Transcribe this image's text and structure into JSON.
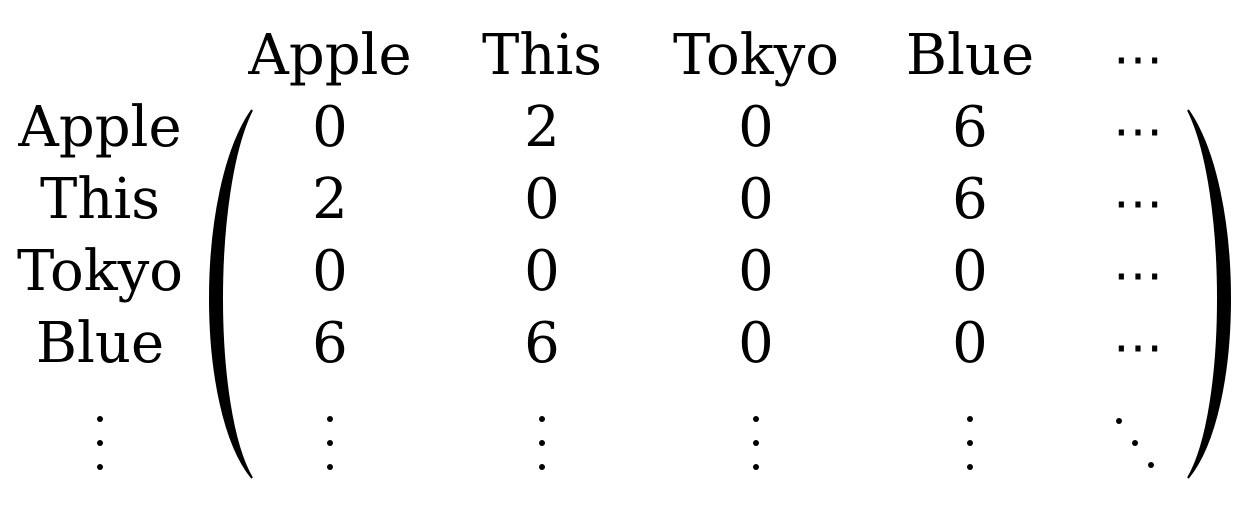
{
  "matrix": {
    "column_labels": [
      "Apple",
      "This",
      "Tokyo",
      "Blue"
    ],
    "row_labels": [
      "Apple",
      "This",
      "Tokyo",
      "Blue"
    ],
    "values": [
      [
        "0",
        "2",
        "0",
        "6"
      ],
      [
        "2",
        "0",
        "0",
        "6"
      ],
      [
        "0",
        "0",
        "0",
        "0"
      ],
      [
        "6",
        "6",
        "0",
        "0"
      ]
    ],
    "continuation_symbol": "⋯"
  }
}
